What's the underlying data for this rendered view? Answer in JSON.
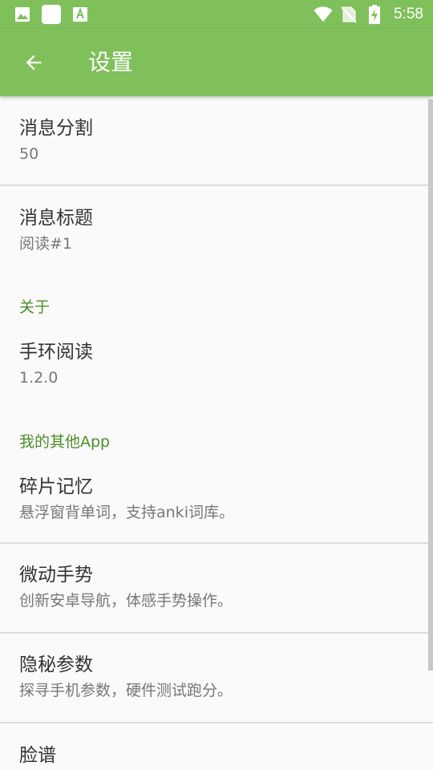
{
  "status_bar": {
    "left_icons": [
      "image-icon",
      "square-icon",
      "font-icon"
    ],
    "right_icons": [
      "wifi-icon",
      "no-sim-icon",
      "battery-charging-icon"
    ],
    "time": "5:58"
  },
  "app_bar": {
    "title": "设置",
    "back_icon": "arrow-back-icon",
    "color": "#7fc05b"
  },
  "prefs": {
    "split": {
      "title": "消息分割",
      "summary": "50"
    },
    "msg_title": {
      "title": "消息标题",
      "summary": "阅读#1"
    },
    "about_category": "关于",
    "app_info": {
      "title": "手环阅读",
      "summary": "1.2.0"
    },
    "other_apps_category": "我的其他App",
    "apps": [
      {
        "title": "碎片记忆",
        "summary": "悬浮窗背单词，支持anki词库。"
      },
      {
        "title": "微动手势",
        "summary": "创新安卓导航，体感手势操作。"
      },
      {
        "title": "隐秘参数",
        "summary": "探寻手机参数，硬件测试跑分。"
      },
      {
        "title": "脸谱"
      }
    ]
  },
  "colors": {
    "accent": "#4a8f2a",
    "primary": "#7fc05b",
    "background": "#fafafa"
  }
}
